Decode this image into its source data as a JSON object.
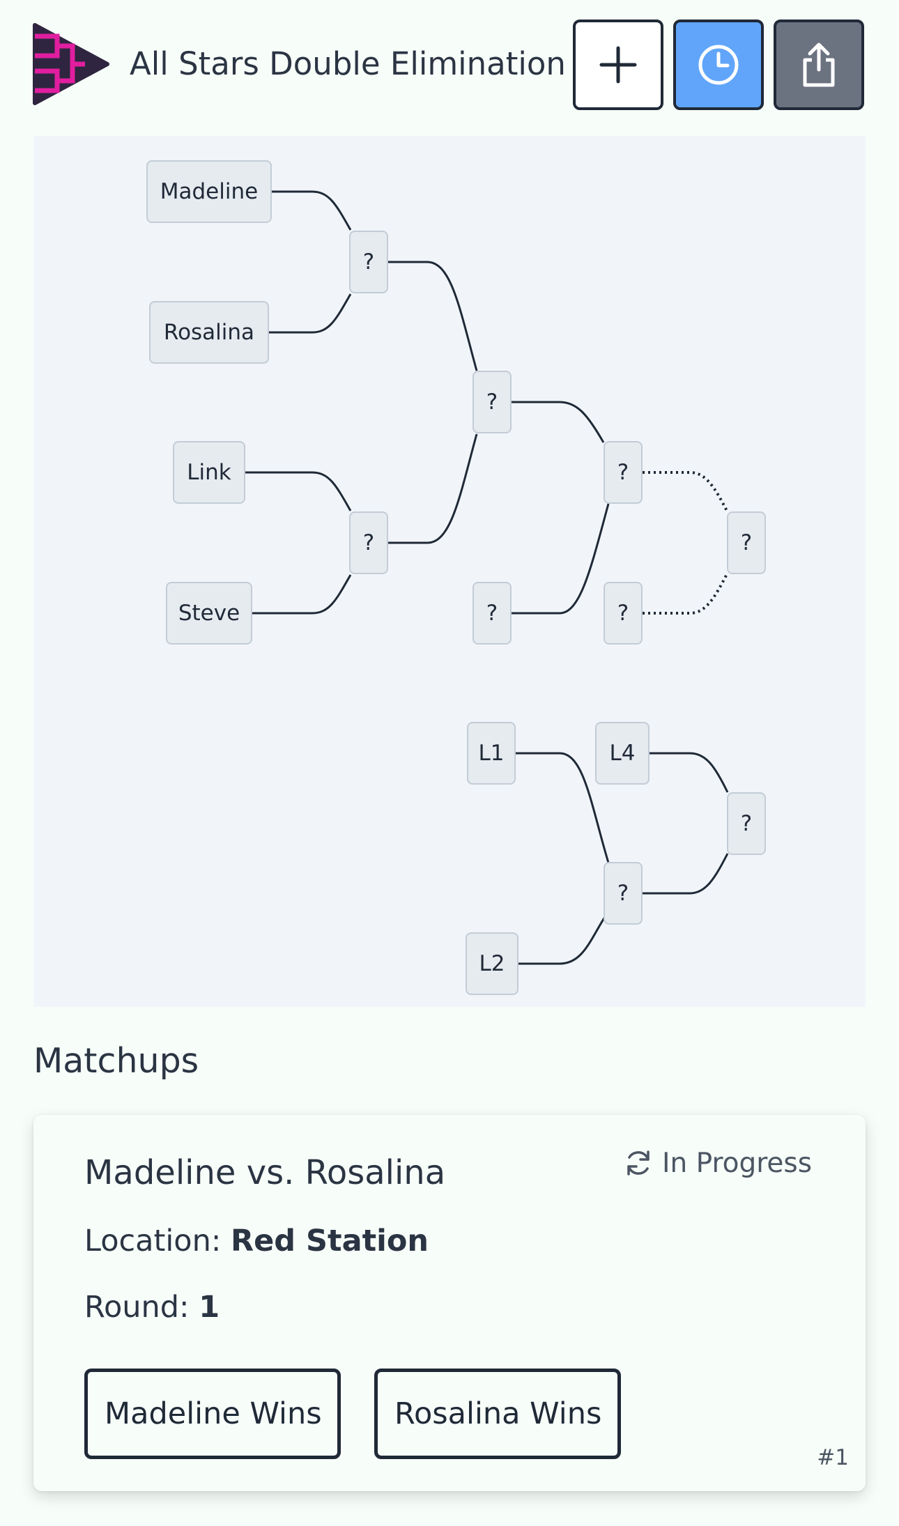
{
  "header": {
    "title": "All Stars Double Elimination",
    "buttons": [
      {
        "name": "add-bracket-button",
        "icon": "plus-icon"
      },
      {
        "name": "history-button",
        "icon": "clock-icon",
        "color": "#60a5fa"
      },
      {
        "name": "share-button",
        "icon": "share-icon",
        "color": "#6b7280"
      }
    ],
    "logo_colors": {
      "triangle": "#2f2540",
      "bracket": "#e01e9f"
    }
  },
  "bracket": {
    "winners": {
      "round1": [
        {
          "top": "Madeline",
          "bottom": "Rosalina",
          "winner": "?"
        },
        {
          "top": "Link",
          "bottom": "Steve",
          "winner": "?"
        }
      ],
      "semifinal": "?",
      "bye": "?",
      "final": "?",
      "grand_final_other": "?",
      "champion": "?"
    },
    "losers": {
      "l1": "L1",
      "l2": "L2",
      "l4": "L4",
      "round1_winner": "?",
      "final": "?"
    }
  },
  "matchups": {
    "heading": "Matchups",
    "cards": [
      {
        "title": "Madeline vs. Rosalina",
        "status": "In Progress",
        "location_label": "Location:",
        "location": "Red Station",
        "round_label": "Round:",
        "round": "1",
        "buttons": [
          "Madeline Wins",
          "Rosalina Wins"
        ],
        "number": "#1"
      }
    ]
  }
}
